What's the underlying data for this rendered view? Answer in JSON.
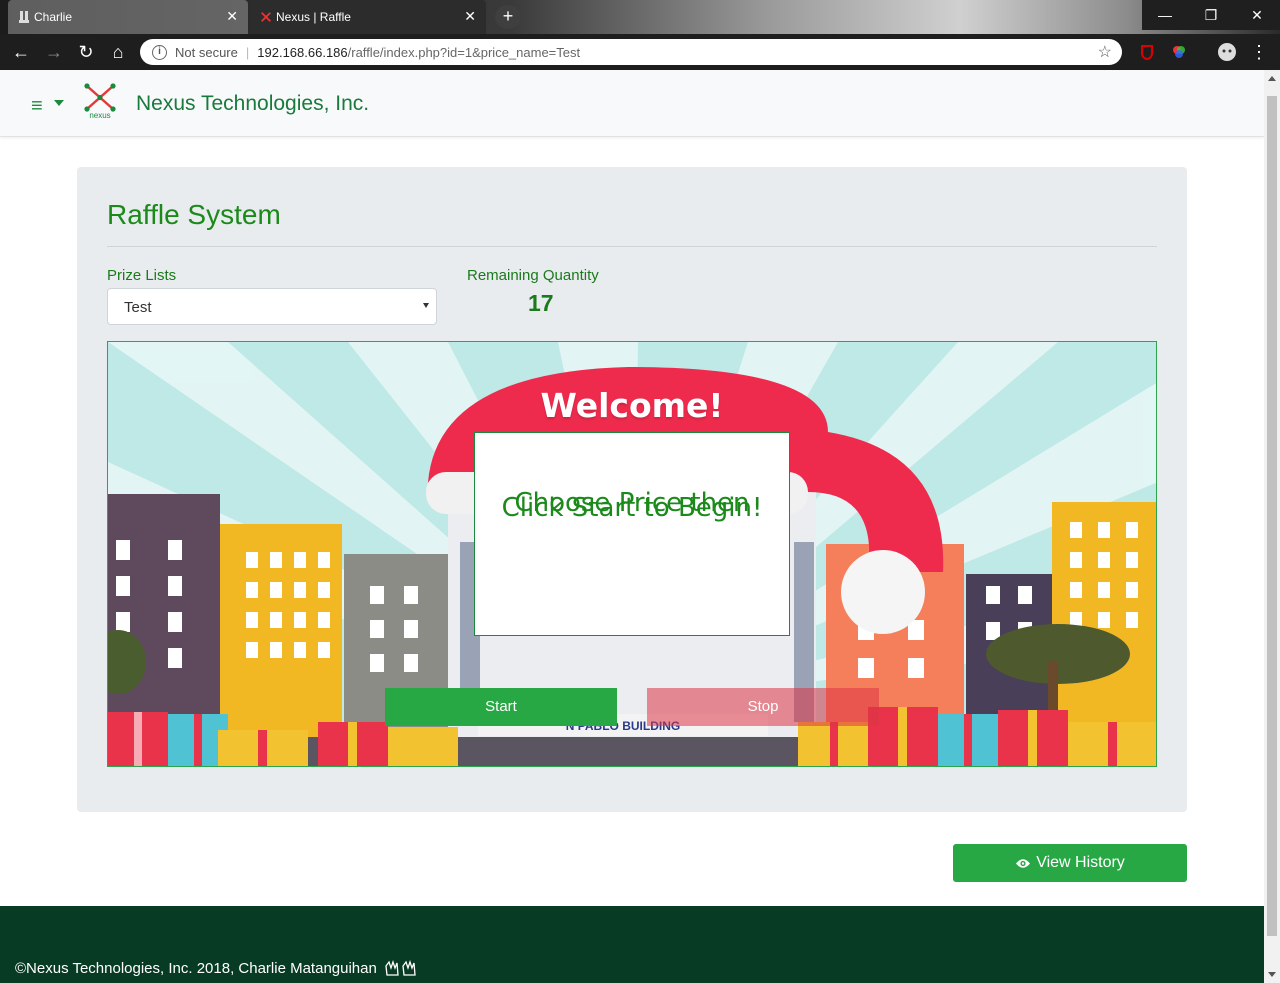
{
  "browser": {
    "tabs": [
      {
        "label": "Charlie",
        "active": false
      },
      {
        "label": "Nexus | Raffle",
        "active": true
      }
    ],
    "security_label": "Not secure",
    "url_host": "192.168.66.186",
    "url_path": "/raffle/index.php?id=1&price_name=Test"
  },
  "header": {
    "brand_name": "Nexus Technologies, Inc.",
    "logo_text": "nexus"
  },
  "card": {
    "title": "Raffle System",
    "prize_label": "Prize Lists",
    "prize_selected": "Test",
    "quantity_label": "Remaining Quantity",
    "quantity_value": "17"
  },
  "scene": {
    "welcome": "Welcome!",
    "message_line1": "Choose Price then",
    "message_line2": "Click Start to Begin!",
    "building_sign": "N PABLO BUILDING"
  },
  "actions": {
    "start_label": "Start",
    "stop_label": "Stop",
    "history_label": "View History"
  },
  "footer": {
    "copyright": "©Nexus Technologies, Inc.   2018, Charlie Matanguihan"
  },
  "colors": {
    "brand_green": "#1b8a3e",
    "start_green": "#28a745",
    "stop_red": "#dc3545",
    "footer_bg": "#073b24"
  }
}
